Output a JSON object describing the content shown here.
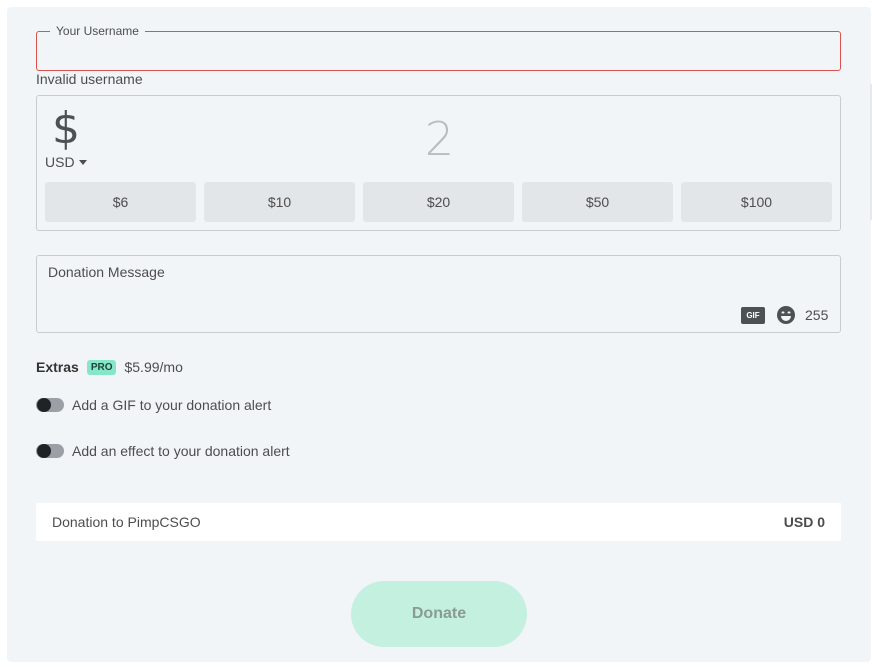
{
  "username": {
    "legend": "Your Username",
    "value": "",
    "error": "Invalid username"
  },
  "amount": {
    "currency_symbol": "$",
    "currency": "USD",
    "value": "2",
    "presets": [
      "$6",
      "$10",
      "$20",
      "$50",
      "$100"
    ]
  },
  "message": {
    "placeholder": "Donation Message",
    "gif_label": "GIF",
    "emoji_icon": "emoji-icon",
    "chars_left": "255"
  },
  "extras": {
    "label": "Extras",
    "badge": "PRO",
    "price": "$5.99/mo",
    "options": [
      {
        "label": "Add a GIF to your donation alert",
        "enabled": false
      },
      {
        "label": "Add an effect to your donation alert",
        "enabled": false
      }
    ]
  },
  "summary": {
    "recipient": "Donation to PimpCSGO",
    "total": "USD 0"
  },
  "donate_button": "Donate",
  "colors": {
    "error": "#d9534f",
    "accent": "#85e6c8",
    "donate_bg": "#c4f0e0"
  }
}
